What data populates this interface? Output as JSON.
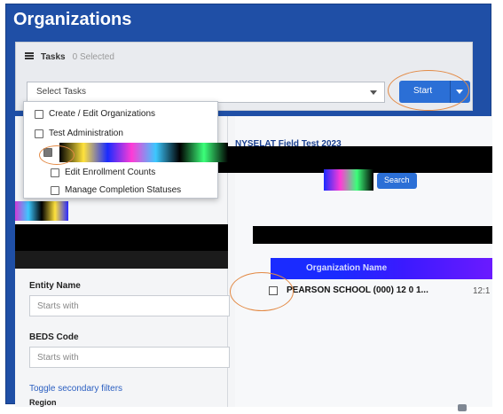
{
  "page": {
    "title": "Organizations"
  },
  "tasks": {
    "label": "Tasks",
    "selected_count": "0 Selected",
    "select_placeholder": "Select Tasks",
    "start_label": "Start"
  },
  "task_menu": {
    "items": [
      {
        "label": "Create / Edit Organizations",
        "checked": false
      },
      {
        "label": "Test Administration",
        "checked": false
      },
      {
        "label": "",
        "checked": true
      },
      {
        "label": "Edit Enrollment Counts",
        "checked": false
      },
      {
        "label": "Manage Completion Statuses",
        "checked": false
      }
    ]
  },
  "filters": {
    "entity_name_label": "Entity Name",
    "entity_name_placeholder": "Starts with",
    "beds_code_label": "BEDS Code",
    "beds_code_placeholder": "Starts with",
    "toggle_secondary": "Toggle secondary filters",
    "cutoff_label": "Region"
  },
  "results": {
    "test_header_link": "NYSELAT Field Test 2023",
    "search_button": "Search",
    "column_link": "Organization Name",
    "row_text": "PEARSON SCHOOL (000) 12 0 1...",
    "row_time": "12:1"
  },
  "colors": {
    "brand_blue": "#1f4fa6",
    "start_button": "#2b6fd6",
    "highlight_circle": "#e38a45",
    "link": "#2b5fc1"
  }
}
